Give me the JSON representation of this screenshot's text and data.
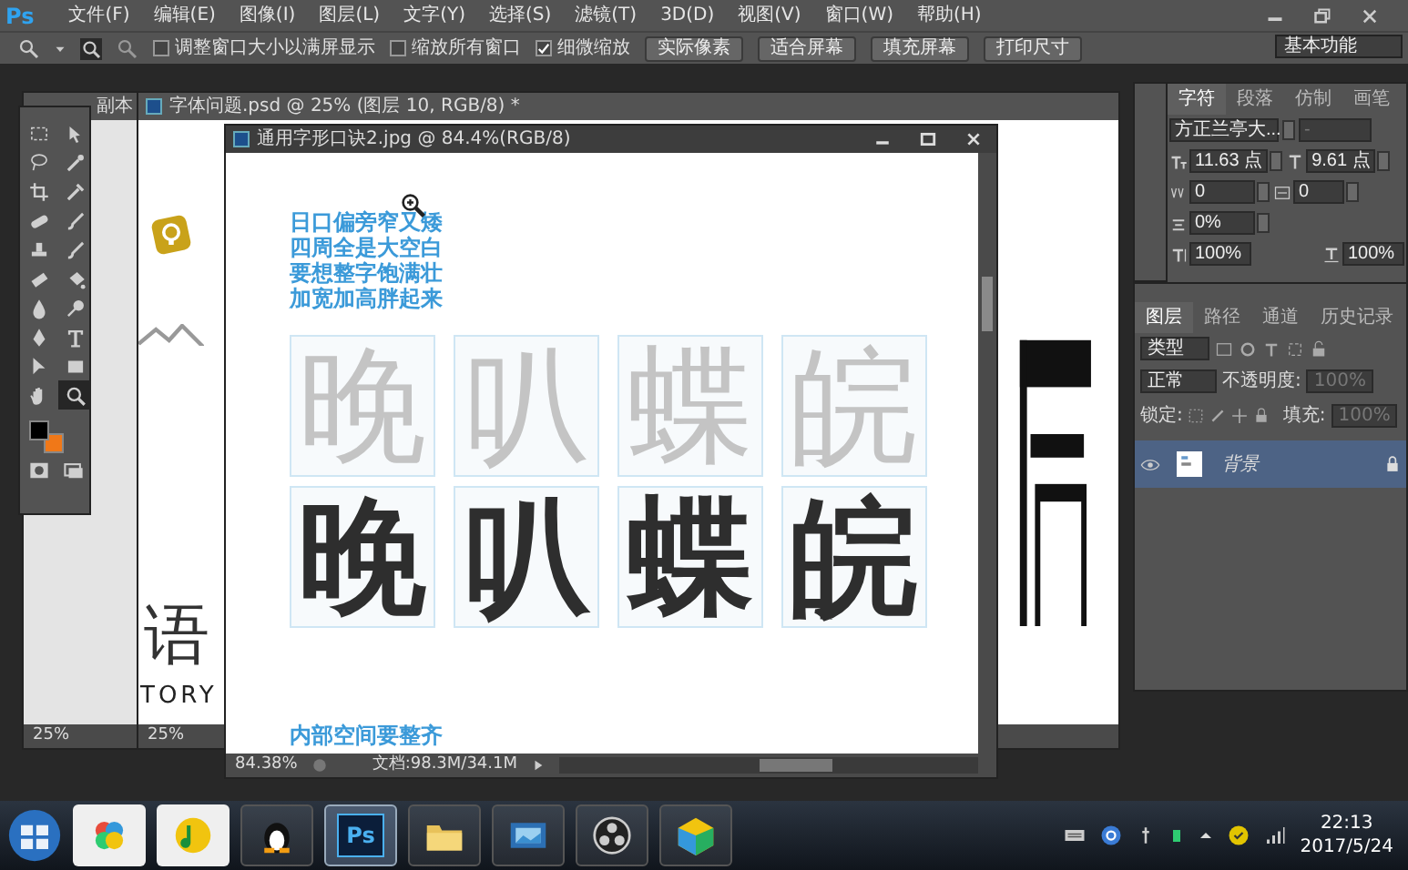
{
  "app": {
    "logo": "Ps",
    "menu": [
      "文件(F)",
      "编辑(E)",
      "图像(I)",
      "图层(L)",
      "文字(Y)",
      "选择(S)",
      "滤镜(T)",
      "3D(D)",
      "视图(V)",
      "窗口(W)",
      "帮助(H)"
    ]
  },
  "options_bar": {
    "checkboxes": [
      {
        "label": "调整窗口大小以满屏显示",
        "checked": false
      },
      {
        "label": "缩放所有窗口",
        "checked": false
      },
      {
        "label": "细微缩放",
        "checked": true
      }
    ],
    "buttons": [
      "实际像素",
      "适合屏幕",
      "填充屏幕",
      "打印尺寸"
    ],
    "workspace": "基本功能"
  },
  "tools": [
    {
      "kind": "marquee",
      "selected": false
    },
    {
      "kind": "move",
      "selected": false
    },
    {
      "kind": "lasso",
      "selected": false
    },
    {
      "kind": "wand",
      "selected": false
    },
    {
      "kind": "crop",
      "selected": false
    },
    {
      "kind": "eyedropper",
      "selected": false
    },
    {
      "kind": "healing",
      "selected": false
    },
    {
      "kind": "brush",
      "selected": false
    },
    {
      "kind": "stamp",
      "selected": false
    },
    {
      "kind": "brush",
      "selected": false
    },
    {
      "kind": "eraser",
      "selected": false
    },
    {
      "kind": "bucket",
      "selected": false
    },
    {
      "kind": "blur",
      "selected": false
    },
    {
      "kind": "dodge",
      "selected": false
    },
    {
      "kind": "pen",
      "selected": false
    },
    {
      "kind": "type",
      "selected": false
    },
    {
      "kind": "path",
      "selected": false
    },
    {
      "kind": "shape",
      "selected": false
    },
    {
      "kind": "hand",
      "selected": false
    },
    {
      "kind": "zoom",
      "selected": true
    }
  ],
  "swatches": [
    {
      "color": "#000000"
    },
    {
      "color": "#f07818"
    }
  ],
  "left_document": {
    "title": "副本",
    "zoom": "25%"
  },
  "back_document": {
    "title": "字体问题.psd @ 25% (图层 10, RGB/8) *",
    "texts": [
      "语",
      "TORY"
    ],
    "zoom": "25%"
  },
  "front_document": {
    "title": "通用字形口诀2.jpg @ 84.4%(RGB/8)",
    "tips": [
      "日口偏旁窄又矮",
      "四周全是大空白",
      "要想整字饱满壮",
      "加宽加高胖起来"
    ],
    "glyphs_light": [
      "晚",
      "叭",
      "蝶",
      "皖"
    ],
    "glyphs_bold": [
      "晚",
      "叭",
      "蝶",
      "皖"
    ],
    "bottom_tips": [
      "内部空间要整齐"
    ],
    "zoom": "84.38%",
    "doc_size": "文档:98.3M/34.1M"
  },
  "character_panel": {
    "tabs": [
      {
        "label": "字符",
        "selected": true
      },
      {
        "label": "段落",
        "selected": false
      },
      {
        "label": "仿制",
        "selected": false
      },
      {
        "label": "画笔",
        "selected": false
      }
    ],
    "font": "方正兰亭大...",
    "font_style": "-",
    "fields": [
      {
        "kind": "size",
        "value": "11.63 点"
      },
      {
        "kind": "leading",
        "value": "9.61 点"
      },
      {
        "kind": "kerning",
        "value": "0"
      },
      {
        "kind": "tracking",
        "value": "0"
      },
      {
        "kind": "tsume",
        "value": "0%"
      },
      {
        "kind": "vscale",
        "value": "100%"
      },
      {
        "kind": "hscale",
        "value": "100%"
      }
    ]
  },
  "layers_panel": {
    "tabs": [
      {
        "label": "图层",
        "selected": true
      },
      {
        "label": "路径",
        "selected": false
      },
      {
        "label": "通道",
        "selected": false
      },
      {
        "label": "历史记录",
        "selected": false
      }
    ],
    "filter": "类型",
    "blend": "正常",
    "opacity_label": "不透明度:",
    "opacity": "100%",
    "lock_label": "锁定:",
    "fill_label": "填充:",
    "fill": "100%",
    "layers": [
      {
        "name": "背景",
        "selected": true,
        "visible": true,
        "locked": true
      }
    ]
  },
  "taskbar": {
    "apps": [
      {
        "kind": "petals",
        "running": false,
        "active": false
      },
      {
        "kind": "music",
        "running": false,
        "active": false
      },
      {
        "kind": "penguin",
        "running": true,
        "active": false
      },
      {
        "kind": "photoshop",
        "label": "Ps",
        "running": true,
        "active": true
      },
      {
        "kind": "folder",
        "running": true,
        "active": false
      },
      {
        "kind": "picture",
        "running": true,
        "active": false
      },
      {
        "kind": "record",
        "running": true,
        "active": false
      },
      {
        "kind": "cube",
        "running": true,
        "active": false
      }
    ],
    "time": "22:13",
    "date": "2017/5/24"
  }
}
